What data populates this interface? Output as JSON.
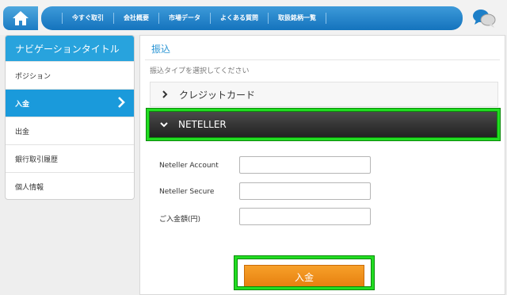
{
  "header": {
    "nav_items": [
      "今すぐ取引",
      "会社概要",
      "市場データ",
      "よくある質問",
      "取扱銘柄一覧"
    ]
  },
  "sidebar": {
    "title": "ナビゲーションタイトル",
    "items": [
      {
        "label": "ポジション",
        "active": false
      },
      {
        "label": "入金",
        "active": true
      },
      {
        "label": "出金",
        "active": false
      },
      {
        "label": "銀行取引履歴",
        "active": false
      },
      {
        "label": "個人情報",
        "active": false
      }
    ]
  },
  "main": {
    "title": "振込",
    "instruction": "振込タイプを選択してください",
    "options": [
      {
        "label": "クレジットカード",
        "expanded": false
      },
      {
        "label": "NETELLER",
        "expanded": true
      }
    ],
    "form": {
      "account_label": "Neteller Account",
      "account_value": "",
      "secure_label": "Neteller Secure",
      "secure_value": "",
      "amount_label": "ご入金額(円)",
      "amount_value": ""
    },
    "submit_label": "入金"
  },
  "colors": {
    "accent_blue": "#1a9adb",
    "submit_orange": "#f29020",
    "highlight_green": "#22dd22"
  }
}
